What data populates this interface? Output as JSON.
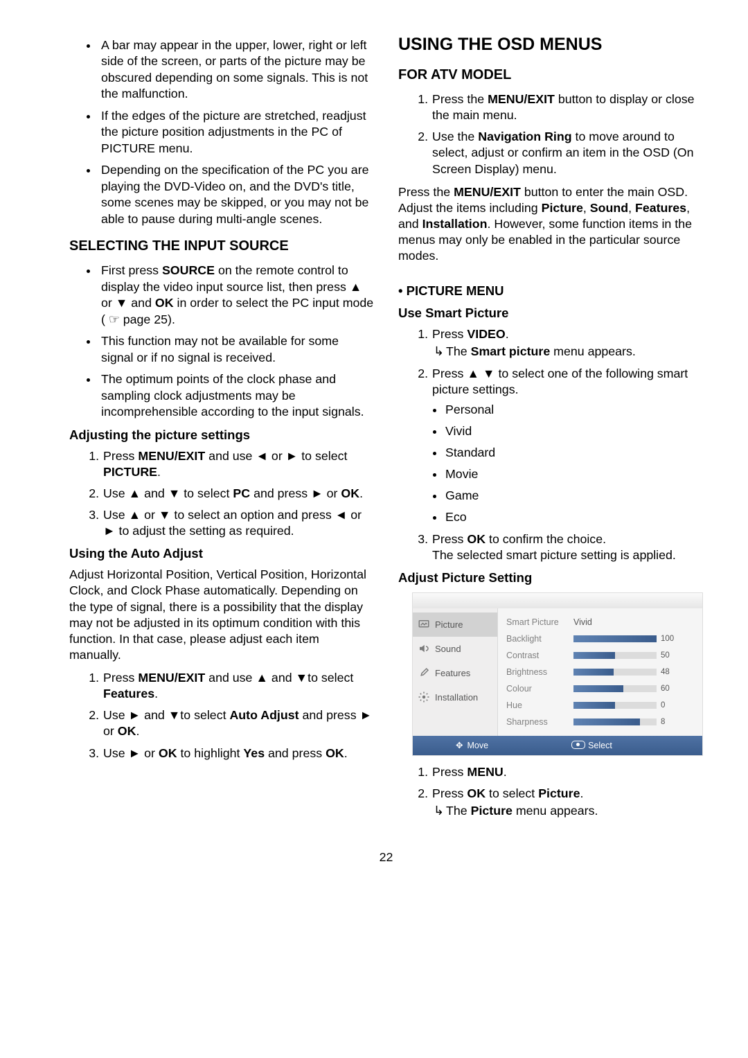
{
  "page_number": "22",
  "left": {
    "top_bullets": [
      "A bar may appear in the upper, lower, right or left side of the screen, or parts of the picture may be obscured depending on some signals. This is not the malfunction.",
      "If the edges of the picture are stretched, readjust the picture position adjustments in the PC of PICTURE menu.",
      "Depending on the specification of the PC you are playing the DVD-Video on, and the DVD's title, some scenes may be skipped, or you may not be able to pause during multi-angle scenes."
    ],
    "h2a": "SELECTING THE INPUT SOURCE",
    "sel_bullets_pre": "First press ",
    "source_b": "SOURCE",
    "sel_bullets_mid": " on the remote control to display the video input source list, then press ▲ or ▼ and ",
    "ok_b": "OK",
    "sel_bullets_end": " in order to select the PC input mode ( ☞ page 25).",
    "sel_bullets2": "This function may not be available for some signal or if no signal is received.",
    "sel_bullets3": "The optimum points of the clock phase and sampling clock adjustments may be incomprehensible according to the input signals.",
    "h4a": "Adjusting the picture settings",
    "adj1_a": "Press ",
    "menuexit_b": "MENU/EXIT",
    "adj1_b": " and use ◄ or ► to select ",
    "picture_b": "PICTURE",
    "adj2_a": "Use ▲ and ▼ to select ",
    "pc_b": "PC",
    "adj2_b": " and press ► or ",
    "adj3": "Use ▲ or ▼ to select an option and press ◄ or ► to adjust the setting as required.",
    "h4b": "Using the Auto Adjust",
    "autoadj_para": "Adjust Horizontal Position, Vertical Position, Horizontal Clock, and Clock Phase automatically. Depending on the type of signal, there is a possibility that the display may not be adjusted in its optimum condition with this function. In that case, please adjust each item manually.",
    "auto1_a": "Press ",
    "auto1_b": " and use ▲ and ▼to select ",
    "features_b": "Features",
    "auto2_a": "Use ► and ▼to select ",
    "autoadjust_b": "Auto Adjust",
    "auto2_b": " and press ► or ",
    "auto3_a": "Use ► or ",
    "auto3_b": " to highlight ",
    "yes_b": "Yes",
    "auto3_c": " and press "
  },
  "right": {
    "h1": "USING THE OSD MENUS",
    "h2a": "FOR ATV MODEL",
    "atv1_a": "Press the ",
    "atv1_b": " button to display or close the main menu.",
    "atv2_a": "Use the ",
    "navring_b": "Navigation Ring",
    "atv2_b": " to move around to select, adjust or confirm an item in the OSD (On Screen Display) menu.",
    "para1_a": "Press the ",
    "para1_b": " button to enter the main OSD. Adjust the items including ",
    "picture_b": "Picture",
    "sound_b": "Sound",
    "features_b": "Features",
    "and": ", and ",
    "installation_b": "Installation",
    "para1_c": ". However, some function items in the menus may only be enabled in the particular source modes.",
    "h3pm": "PICTURE MENU",
    "h4usp": "Use Smart Picture",
    "usp1_a": "Press ",
    "video_b": "VIDEO",
    "usp1_note_a": "The ",
    "smartpic_b": "Smart picture",
    "usp1_note_b": " menu appears.",
    "usp2": "Press ▲  ▼ to select one of the following smart picture settings.",
    "smart_options": [
      "Personal",
      "Vivid",
      "Standard",
      "Movie",
      "Game",
      "Eco"
    ],
    "usp3_a": "Press ",
    "usp3_b": " to confirm the choice.",
    "usp3_c": "The selected smart picture setting is applied.",
    "h4aps": "Adjust Picture Setting",
    "aps1": "Press ",
    "menu_b": "MENU",
    "aps2_a": "Press ",
    "aps2_b": " to select ",
    "aps_note_a": "The ",
    "aps_note_b": " menu appears."
  },
  "osd": {
    "side": [
      {
        "label": "Picture"
      },
      {
        "label": "Sound"
      },
      {
        "label": "Features"
      },
      {
        "label": "Installation"
      }
    ],
    "rows": [
      {
        "label": "Smart Picture",
        "text": "Vivid"
      },
      {
        "label": "Backlight",
        "value": 100
      },
      {
        "label": "Contrast",
        "value": 50
      },
      {
        "label": "Brightness",
        "value": 48
      },
      {
        "label": "Colour",
        "value": 60
      },
      {
        "label": "Hue",
        "value": 0
      },
      {
        "label": "Sharpness",
        "value": 8
      }
    ],
    "foot_move": "Move",
    "foot_select": "Select"
  }
}
